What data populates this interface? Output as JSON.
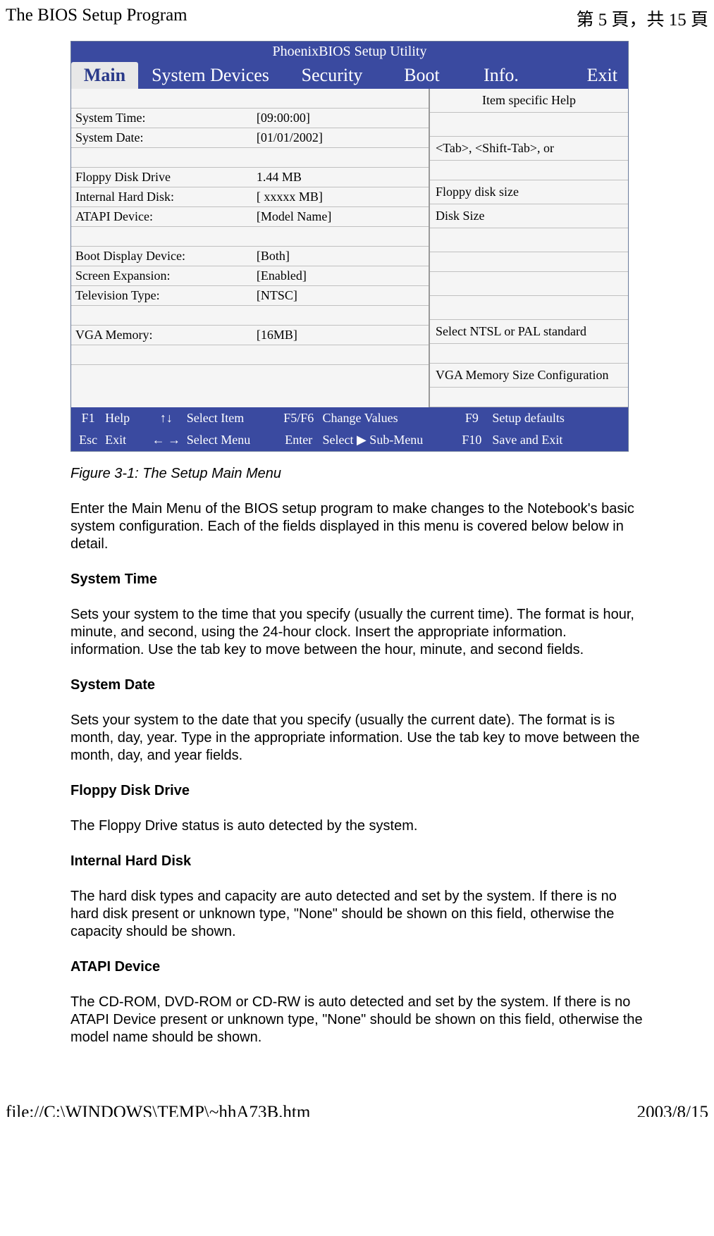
{
  "header": {
    "left": "The BIOS Setup Program",
    "right": "第 5 頁，共 15 頁"
  },
  "bios": {
    "window_title": "PhoenixBIOS Setup Utility",
    "tabs": [
      "Main",
      "System Devices",
      "Security",
      "Boot",
      "Info.",
      "Exit"
    ],
    "rows": [
      {
        "label": "System Time:",
        "value": "[09:00:00]"
      },
      {
        "label": "System Date:",
        "value": "[01/01/2002]"
      },
      {
        "label": "Floppy Disk Drive",
        "value": "1.44 MB"
      },
      {
        "label": "Internal Hard Disk:",
        "value": "[ xxxxx MB]"
      },
      {
        "label": "ATAPI Device:",
        "value": "[Model Name]"
      },
      {
        "label": "Boot Display Device:",
        "value": "[Both]"
      },
      {
        "label": "Screen Expansion:",
        "value": "[Enabled]"
      },
      {
        "label": "Television Type:",
        "value": "[NTSC]"
      },
      {
        "label": "VGA Memory:",
        "value": "[16MB]"
      }
    ],
    "help_header": "Item specific Help",
    "help": {
      "system_date": "<Tab>, <Shift-Tab>, or",
      "floppy": "Floppy disk size",
      "hdd": "Disk Size",
      "tv": "Select NTSL or PAL standard",
      "vga": "VGA Memory Size Configuration"
    },
    "footer": {
      "f1": "F1",
      "help": "Help",
      "updown": "↑↓",
      "select_item": "Select Item",
      "f5f6": "F5/F6",
      "change_values": "Change Values",
      "f9": "F9",
      "setup_defaults": "Setup defaults",
      "esc": "Esc",
      "exit": "Exit",
      "leftright": "← →",
      "select_menu": "Select Menu",
      "enter": "Enter",
      "select_sub": "Select ▶ Sub-Menu",
      "f10": "F10",
      "save_exit": "Save and Exit"
    }
  },
  "caption": "Figure 3-1: The Setup Main Menu",
  "para_intro": "Enter the Main Menu of the BIOS setup program to make changes to the Notebook's basic system configuration. Each of the fields displayed in this menu is covered below below in detail.",
  "sections": {
    "system_time": {
      "head": "System Time",
      "body": "Sets your system to the time that you specify (usually the current time). The format is hour, minute, and second, using the 24-hour clock. Insert the appropriate information. information. Use the tab key to move between the hour, minute, and second fields."
    },
    "system_date": {
      "head": "System Date",
      "body": "Sets your system to the date that you specify (usually the current date). The format is is month, day, year. Type in the appropriate information. Use the tab key to move between the month, day, and year fields."
    },
    "floppy": {
      "head": "Floppy Disk Drive",
      "body": "The Floppy Drive status is auto detected by the system."
    },
    "hdd": {
      "head": "Internal Hard Disk",
      "body": "The hard disk types and capacity are auto detected and set by the system. If there is no hard disk present or unknown type, \"None\" should be shown on this field, otherwise the capacity should be shown."
    },
    "atapi": {
      "head": "ATAPI Device",
      "body": "The CD-ROM, DVD-ROM or CD-RW is auto detected and set by the system. If there is no ATAPI Device present or unknown type, \"None\" should be shown on this field, otherwise the model name should be shown."
    }
  },
  "footer": {
    "left": "file://C:\\WINDOWS\\TEMP\\~hhA73B.htm",
    "right": "2003/8/15"
  }
}
